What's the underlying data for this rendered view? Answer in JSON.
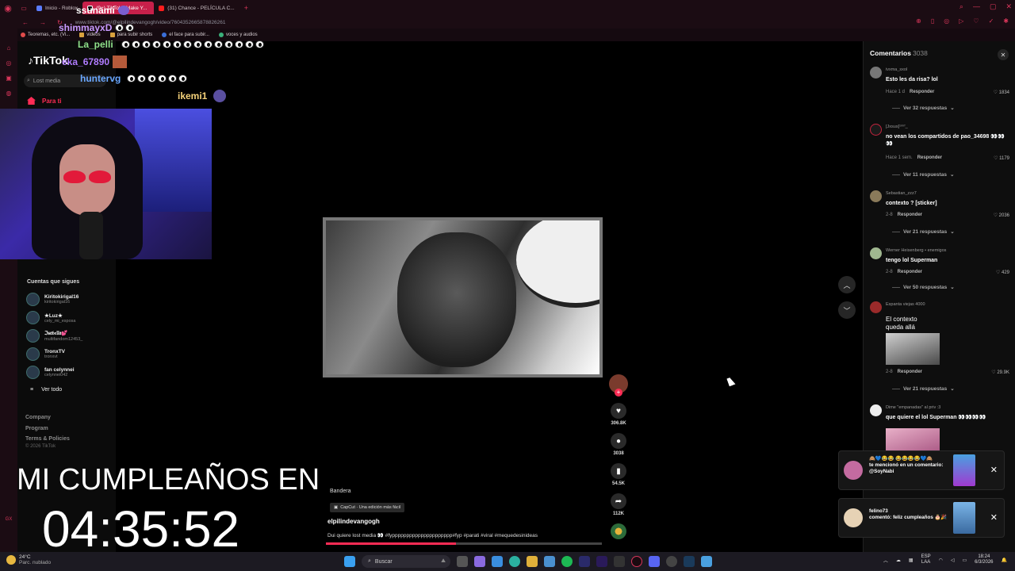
{
  "browser": {
    "tabs": [
      {
        "label": "Inicio - Roblox",
        "kind": "roblox",
        "active": false
      },
      {
        "label": "(9+) TikTok - Make Y...",
        "kind": "tiktok",
        "active": true
      },
      {
        "label": "(31) Chance - PELÍCULA C...",
        "kind": "youtube",
        "active": false
      }
    ],
    "url": "www.tiktok.com/@elpilindevangogh/video/7604352665878826261",
    "bookmarks": [
      "Teoremas, etc. (Vi...",
      "videos",
      "para subir shorts",
      "el face para subir...",
      "voces y audios"
    ]
  },
  "chat": [
    {
      "user": "ssunami",
      "color": "#ffffff",
      "eyes": 0,
      "image": true
    },
    {
      "user": "shimmayxD",
      "color": "#c89bff",
      "eyes": 2,
      "image": false
    },
    {
      "user": "La_pelli",
      "color": "#8fe08a",
      "eyes": 7,
      "image": false
    },
    {
      "user": "eka_67890",
      "color": "#b07cff",
      "eyes": 0,
      "image": true
    },
    {
      "user": "huntervg",
      "color": "#6aa7ff",
      "eyes": 3,
      "image": false
    },
    {
      "user": "ikemi1",
      "color": "#f5d27a",
      "eyes": 0,
      "image": true
    }
  ],
  "tiktok": {
    "logo": "TikTok",
    "search_placeholder": "Lost media",
    "nav_para_ti": "Para ti",
    "mas": "Más",
    "following_title": "Cuentas que sigues",
    "following": [
      {
        "name": "Kiritokirigal16",
        "handle": "kiritokirigal16"
      },
      {
        "name": "★Luz★",
        "handle": "cely_mi_esposa"
      },
      {
        "name": "ℑ𝔰𝔞𝔟𝔢𝔩𝔩𝔞💕",
        "handle": "multifandom12453_"
      },
      {
        "name": "TronxTV",
        "handle": "tronxvt"
      },
      {
        "name": "fan celynnei",
        "handle": "celynnei042"
      }
    ],
    "ver_todo": "Ver todo",
    "footer_links": [
      "Company",
      "Program",
      "Terms & Policies"
    ],
    "copyright": "© 2026 TikTok"
  },
  "video": {
    "bandera": "Bandera",
    "capcut": "CapCut · Una edición más fácil",
    "author": "elpilindevangogh",
    "description": "Dui quiere lost media 👀 #fyppppppppppppppppppppp#fyp #parati #viral #mequedesinideas",
    "progress_fraction": 0.47,
    "actions": {
      "likes": "306.8K",
      "comments": "3038",
      "saves": "54.5K",
      "shares": "112K"
    }
  },
  "overlay": {
    "title": "MI CUMPLEAÑOS EN",
    "countdown": "04:35:52"
  },
  "comments_panel": {
    "title": "Comentarios",
    "count": "3038",
    "items": [
      {
        "user": "ivxma_sxol",
        "text": "Esto les da risa? lol",
        "time": "Hace 1 d",
        "reply": "Responder",
        "likes": "1834",
        "replies": "Ver 32 respuestas"
      },
      {
        "user": "[Jxsus]¹ᵐʳᶠ_",
        "text": "no vean los compartidos de pao_34698 👀👀👀",
        "time": "Hace 1 sem.",
        "reply": "Responder",
        "likes": "1179",
        "replies": "Ver 11 respuestas"
      },
      {
        "user": "Sebastian_zzz7",
        "text": "contexto ? [sticker]",
        "time": "2-8",
        "reply": "Responder",
        "likes": "2036",
        "replies": "Ver 21 respuestas"
      },
      {
        "user": "Werner Heisenberg • enemigos",
        "text": "tengo lol Superman",
        "time": "2-8",
        "reply": "Responder",
        "likes": "429",
        "replies": "Ver 50 respuestas"
      },
      {
        "user": "Espanta viejas 4000",
        "text": "El contexto queda allá",
        "time": "2-8",
        "reply": "Responder",
        "likes": "29.9K",
        "replies": "Ver 21 respuestas"
      },
      {
        "user": "Dime \"empanadas\" al priv :3",
        "text": "que quiere el lol Superman 👀👀👀👀",
        "time": "",
        "reply": "",
        "likes": "",
        "replies": ""
      }
    ]
  },
  "notifications": [
    {
      "text": "te mencionó en un comentario: @SoyNabi",
      "prefix": "🙈💙😂😂 😂😂😂😂💙🙈"
    },
    {
      "text": "comentó: feliz cumpleaños 🎂🎉",
      "prefix": "felino73"
    }
  ],
  "taskbar": {
    "temp": "24°C",
    "weather": "Parc. nublado",
    "search": "Buscar",
    "lang": "ESP",
    "lang2": "LAA",
    "time": "18:24",
    "date": "6/3/2026"
  },
  "icons": {
    "accent": "#fe2c55",
    "browser_accent": "#d8365a"
  }
}
